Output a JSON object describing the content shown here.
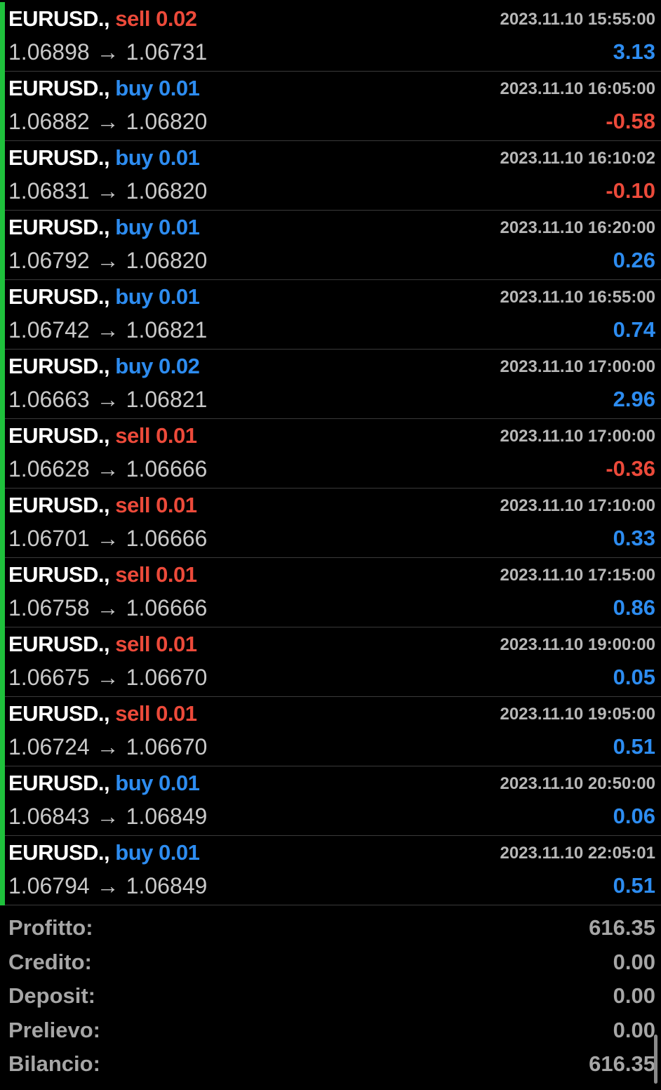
{
  "trades": [
    {
      "symbol": "EURUSD.,",
      "side": "sell",
      "volume": "0.02",
      "time": "2023.11.10 15:55:00",
      "open_price": "1.06898",
      "close_price": "1.06731",
      "profit": "3.13"
    },
    {
      "symbol": "EURUSD.,",
      "side": "buy",
      "volume": "0.01",
      "time": "2023.11.10 16:05:00",
      "open_price": "1.06882",
      "close_price": "1.06820",
      "profit": "-0.58"
    },
    {
      "symbol": "EURUSD.,",
      "side": "buy",
      "volume": "0.01",
      "time": "2023.11.10 16:10:02",
      "open_price": "1.06831",
      "close_price": "1.06820",
      "profit": "-0.10"
    },
    {
      "symbol": "EURUSD.,",
      "side": "buy",
      "volume": "0.01",
      "time": "2023.11.10 16:20:00",
      "open_price": "1.06792",
      "close_price": "1.06820",
      "profit": "0.26"
    },
    {
      "symbol": "EURUSD.,",
      "side": "buy",
      "volume": "0.01",
      "time": "2023.11.10 16:55:00",
      "open_price": "1.06742",
      "close_price": "1.06821",
      "profit": "0.74"
    },
    {
      "symbol": "EURUSD.,",
      "side": "buy",
      "volume": "0.02",
      "time": "2023.11.10 17:00:00",
      "open_price": "1.06663",
      "close_price": "1.06821",
      "profit": "2.96"
    },
    {
      "symbol": "EURUSD.,",
      "side": "sell",
      "volume": "0.01",
      "time": "2023.11.10 17:00:00",
      "open_price": "1.06628",
      "close_price": "1.06666",
      "profit": "-0.36"
    },
    {
      "symbol": "EURUSD.,",
      "side": "sell",
      "volume": "0.01",
      "time": "2023.11.10 17:10:00",
      "open_price": "1.06701",
      "close_price": "1.06666",
      "profit": "0.33"
    },
    {
      "symbol": "EURUSD.,",
      "side": "sell",
      "volume": "0.01",
      "time": "2023.11.10 17:15:00",
      "open_price": "1.06758",
      "close_price": "1.06666",
      "profit": "0.86"
    },
    {
      "symbol": "EURUSD.,",
      "side": "sell",
      "volume": "0.01",
      "time": "2023.11.10 19:00:00",
      "open_price": "1.06675",
      "close_price": "1.06670",
      "profit": "0.05"
    },
    {
      "symbol": "EURUSD.,",
      "side": "sell",
      "volume": "0.01",
      "time": "2023.11.10 19:05:00",
      "open_price": "1.06724",
      "close_price": "1.06670",
      "profit": "0.51"
    },
    {
      "symbol": "EURUSD.,",
      "side": "buy",
      "volume": "0.01",
      "time": "2023.11.10 20:50:00",
      "open_price": "1.06843",
      "close_price": "1.06849",
      "profit": "0.06"
    },
    {
      "symbol": "EURUSD.,",
      "side": "buy",
      "volume": "0.01",
      "time": "2023.11.10 22:05:01",
      "open_price": "1.06794",
      "close_price": "1.06849",
      "profit": "0.51"
    }
  ],
  "arrow_glyph": "→",
  "summary": [
    {
      "label": "Profitto:",
      "value": "616.35"
    },
    {
      "label": "Credito:",
      "value": "0.00"
    },
    {
      "label": "Deposit:",
      "value": "0.00"
    },
    {
      "label": "Prelievo:",
      "value": "0.00"
    },
    {
      "label": "Bilancio:",
      "value": "616.35"
    }
  ],
  "colors": {
    "buy": "#2d8cf0",
    "sell": "#ec4a3a",
    "profit_positive": "#2d8cf0",
    "profit_negative": "#ec4a3a",
    "row_marker": "#1fc13c",
    "background": "#000000"
  }
}
